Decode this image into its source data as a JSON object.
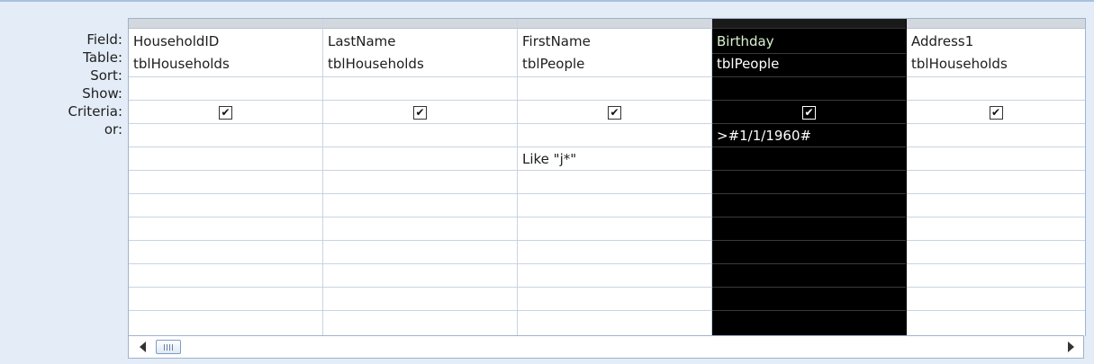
{
  "row_labels": [
    "Field:",
    "Table:",
    "Sort:",
    "Show:",
    "Criteria:",
    "or:"
  ],
  "columns": [
    {
      "field": "HouseholdID",
      "table": "tblHouseholds",
      "sort": "",
      "show": true,
      "criteria": "",
      "or": ""
    },
    {
      "field": "LastName",
      "table": "tblHouseholds",
      "sort": "",
      "show": true,
      "criteria": "",
      "or": ""
    },
    {
      "field": "FirstName",
      "table": "tblPeople",
      "sort": "",
      "show": true,
      "criteria": "",
      "or": "Like \"j*\""
    },
    {
      "field": "Birthday",
      "table": "tblPeople",
      "sort": "",
      "show": true,
      "criteria": ">#1/1/1960#",
      "or": "",
      "selected": true
    },
    {
      "field": "Address1",
      "table": "tblHouseholds",
      "sort": "",
      "show": true,
      "criteria": "",
      "or": ""
    }
  ],
  "checkbox_glyph": "✔",
  "colors": {
    "selected_column": "#000000",
    "grid_border": "#c9d4e2",
    "frame": "#e3ecf7"
  }
}
